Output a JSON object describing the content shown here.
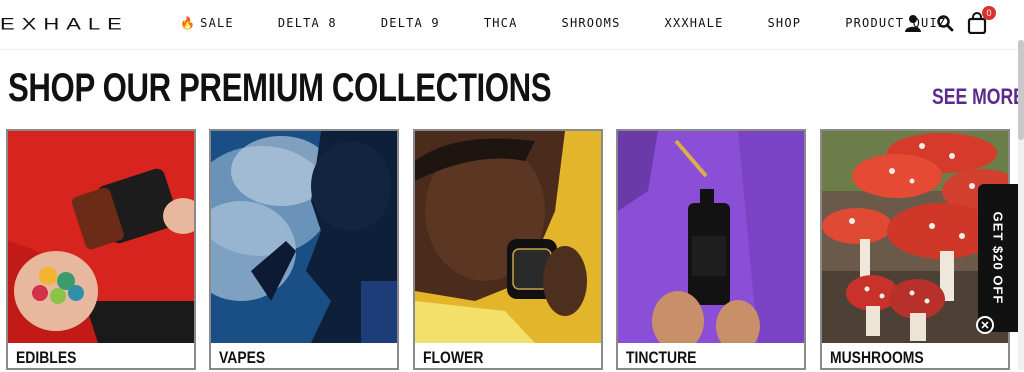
{
  "header": {
    "logo": "EXHALE",
    "nav": [
      {
        "label": "SALE",
        "icon": "flame-icon"
      },
      {
        "label": "DELTA 8"
      },
      {
        "label": "DELTA 9"
      },
      {
        "label": "THCA"
      },
      {
        "label": "SHROOMS"
      },
      {
        "label": "XXXHALE"
      },
      {
        "label": "SHOP"
      },
      {
        "label": "PRODUCT QUIZ"
      }
    ],
    "icons": [
      "user-icon",
      "search-icon",
      "cart-icon"
    ],
    "cart_count": "0"
  },
  "section": {
    "title": "SHOP OUR PREMIUM COLLECTIONS",
    "see_more": "SEE MORE >"
  },
  "collections": [
    {
      "label": "EDIBLES"
    },
    {
      "label": "VAPES"
    },
    {
      "label": "FLOWER"
    },
    {
      "label": "TINCTURE"
    },
    {
      "label": "MUSHROOMS"
    }
  ],
  "promo": {
    "text": "GET $20 OFF"
  },
  "colors": {
    "accent": "#5b2a8c",
    "badge": "#d6322e"
  }
}
